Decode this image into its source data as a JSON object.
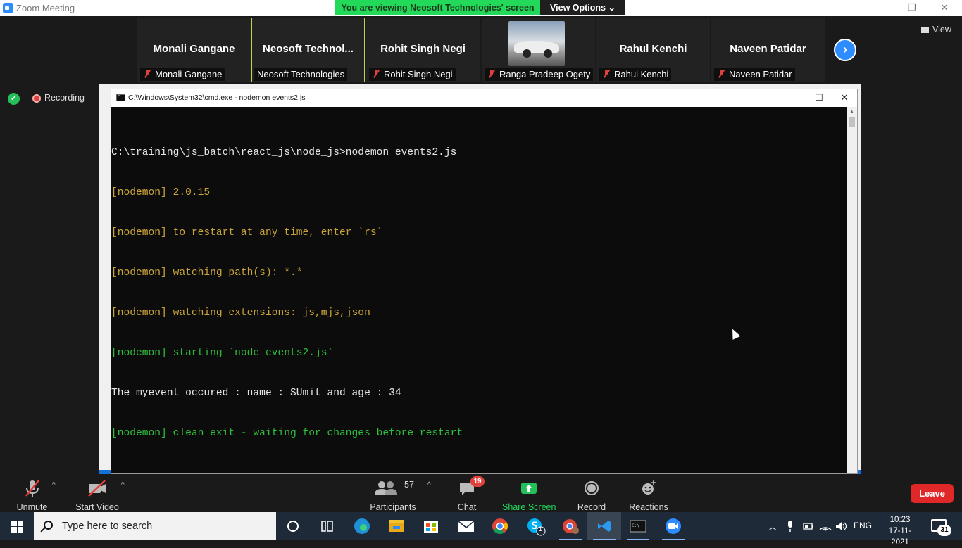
{
  "zoom": {
    "window_title": "Zoom Meeting",
    "share_banner": "You are viewing Neosoft Technologies' screen",
    "view_options": "View Options",
    "view_label": "View",
    "recording_label": "Recording"
  },
  "participants": [
    {
      "big_name": "Monali Gangane",
      "small_name": "Monali Gangane",
      "muted": true
    },
    {
      "big_name": "Neosoft  Technol...",
      "small_name": "Neosoft Technologies",
      "muted": false,
      "active": true
    },
    {
      "big_name": "Rohit Singh Negi",
      "small_name": "Rohit Singh Negi",
      "muted": true
    },
    {
      "big_name": "",
      "small_name": "Ranga Pradeep Ogety",
      "muted": true,
      "has_image": true
    },
    {
      "big_name": "Rahul Kenchi",
      "small_name": "Rahul Kenchi",
      "muted": true
    },
    {
      "big_name": "Naveen Patidar",
      "small_name": "Naveen Patidar",
      "muted": true
    }
  ],
  "cmd": {
    "title": "C:\\Windows\\System32\\cmd.exe - nodemon  events2.js",
    "lines": [
      {
        "text": "C:\\training\\js_batch\\react_js\\node_js>nodemon events2.js",
        "color": "white"
      },
      {
        "text": "[nodemon] 2.0.15",
        "color": "yellow"
      },
      {
        "text": "[nodemon] to restart at any time, enter `rs`",
        "color": "yellow"
      },
      {
        "text": "[nodemon] watching path(s): *.*",
        "color": "yellow"
      },
      {
        "text": "[nodemon] watching extensions: js,mjs,json",
        "color": "yellow"
      },
      {
        "text": "[nodemon] starting `node events2.js`",
        "color": "green"
      },
      {
        "text": "The myevent occured : name : SUmit and age : 34",
        "color": "white"
      },
      {
        "text": "[nodemon] clean exit - waiting for changes before restart",
        "color": "green"
      }
    ]
  },
  "toolbar": {
    "unmute": "Unmute",
    "start_video": "Start Video",
    "participants": "Participants",
    "participants_count": "57",
    "chat": "Chat",
    "chat_badge": "19",
    "share_screen": "Share Screen",
    "record": "Record",
    "reactions": "Reactions",
    "leave": "Leave"
  },
  "taskbar": {
    "search_placeholder": "Type here to search",
    "language": "ENG",
    "time": "10:23",
    "date": "17-11-2021",
    "notification_count": "31",
    "skype_badge": "1"
  },
  "colors": {
    "zoom_blue": "#2d8cff",
    "banner_green": "#23d959",
    "leave_red": "#e02828",
    "terminal_yellow": "#c9a43a",
    "terminal_green": "#2fbd3c"
  }
}
